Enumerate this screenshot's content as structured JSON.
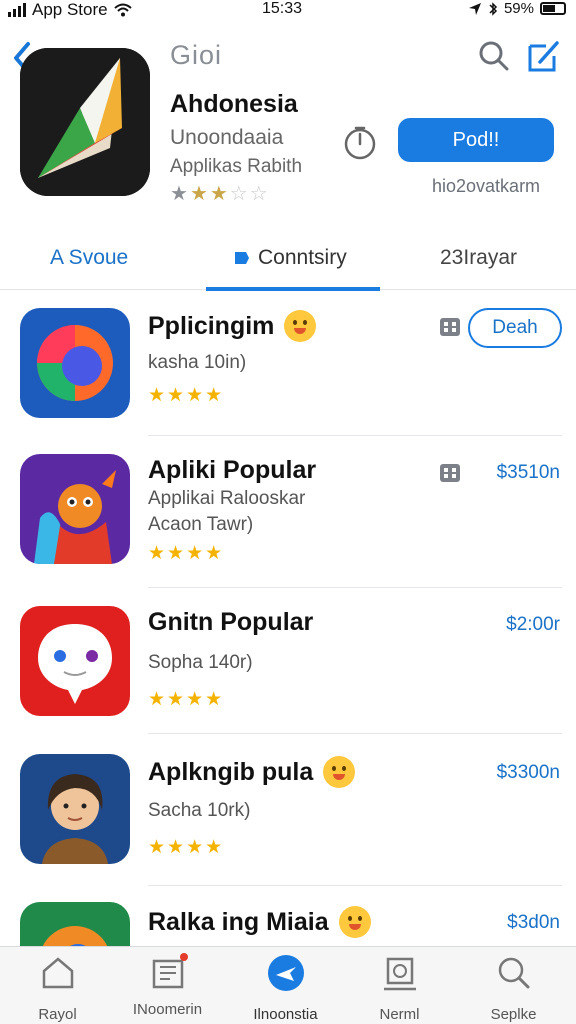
{
  "status_bar": {
    "carrier": "App Store",
    "time": "15:33",
    "battery": "59%"
  },
  "header": {
    "title": "Gioi"
  },
  "featured": {
    "name": "Ahdonesia",
    "subtitle": "Unoondaaia",
    "category": "Applikas Rabith",
    "stars": "★★★☆☆",
    "get_label": "Pod!!",
    "extra": "hio2ovatkarm"
  },
  "tabs": [
    {
      "label": "A Svoue"
    },
    {
      "label": "Conntsiry"
    },
    {
      "label": "23Irayar"
    }
  ],
  "apps": [
    {
      "title": "Pplicingim",
      "sub1": "kasha 10in)",
      "sub2": "",
      "stars": "★★★★",
      "action": "Deah"
    },
    {
      "title": "Apliki Popular",
      "sub1": "Applikai Ralooskar",
      "sub2": "Acaon Tawr)",
      "stars": "★★★★",
      "price": "$3510n"
    },
    {
      "title": "Gnitn Popular",
      "sub1": "Sopha 140r)",
      "sub2": "",
      "stars": "★★★★",
      "price": "$2:00r"
    },
    {
      "title": "Aplkngib pula",
      "sub1": "Sacha 10rk)",
      "sub2": "",
      "stars": "★★★★",
      "price": "$3300n"
    },
    {
      "title": "Ralka ing Miaia",
      "sub1": "",
      "sub2": "",
      "stars": "",
      "price": "$3d0n"
    }
  ],
  "tabbar": [
    {
      "label": "Rayol",
      "icon": "home-icon"
    },
    {
      "label": "INoomerin",
      "icon": "news-icon"
    },
    {
      "label": "Ilnoonstia",
      "icon": "apps-icon"
    },
    {
      "label": "Nerml",
      "icon": "updates-icon"
    },
    {
      "label": "Seplke",
      "icon": "search-icon"
    }
  ],
  "colors": {
    "accent": "#1a7be0",
    "star": "#f5b301"
  }
}
